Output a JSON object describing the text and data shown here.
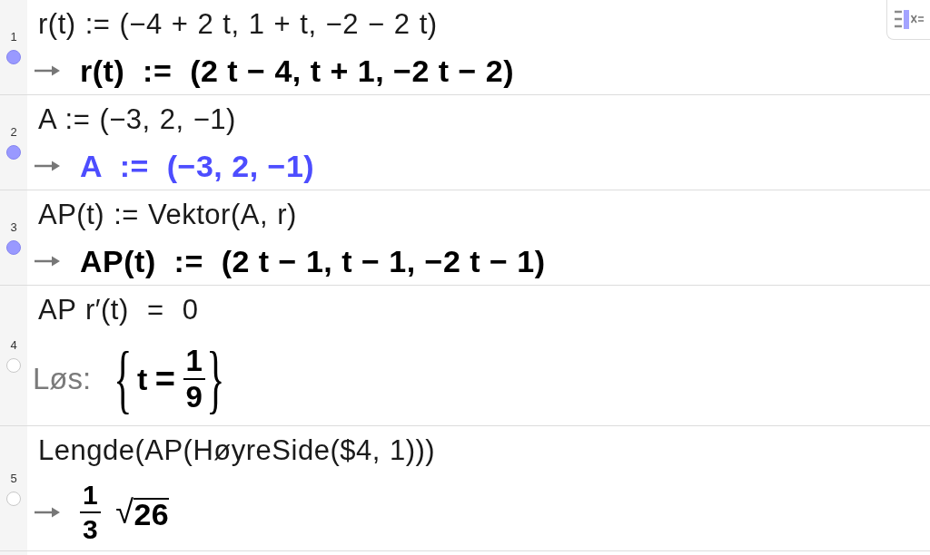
{
  "cas_rows": [
    {
      "number": "1",
      "visible": true,
      "input": "r(t) := (−4 + 2 t, 1 + t, −2 − 2 t)",
      "output": {
        "kind": "value",
        "text": "r(t)  :=  (2 t − 4, t + 1, −2 t − 2)",
        "color": "#000000"
      }
    },
    {
      "number": "2",
      "visible": true,
      "input": "A := (−3, 2, −1)",
      "output": {
        "kind": "value",
        "text": "A  :=  (−3, 2, −1)",
        "color": "#4d4dff"
      }
    },
    {
      "number": "3",
      "visible": true,
      "input": "AP(t) := Vektor(A, r)",
      "output": {
        "kind": "value",
        "text": "AP(t)  :=  (2 t − 1, t − 1, −2 t − 1)",
        "color": "#000000"
      }
    },
    {
      "number": "4",
      "visible": false,
      "input": "AP r′(t)  =  0",
      "output": {
        "kind": "solution",
        "label": "Løs:",
        "open": "{",
        "variable": "t",
        "relation": "=",
        "numerator": "1",
        "denominator": "9",
        "close": "}",
        "color": "#000000"
      }
    },
    {
      "number": "5",
      "visible": false,
      "input": "Lengde(AP(HøyreSide($4, 1)))",
      "output": {
        "kind": "fraction_root",
        "numerator": "1",
        "denominator": "3",
        "radical": "√",
        "radicand": "26",
        "color": "#000000"
      }
    }
  ]
}
